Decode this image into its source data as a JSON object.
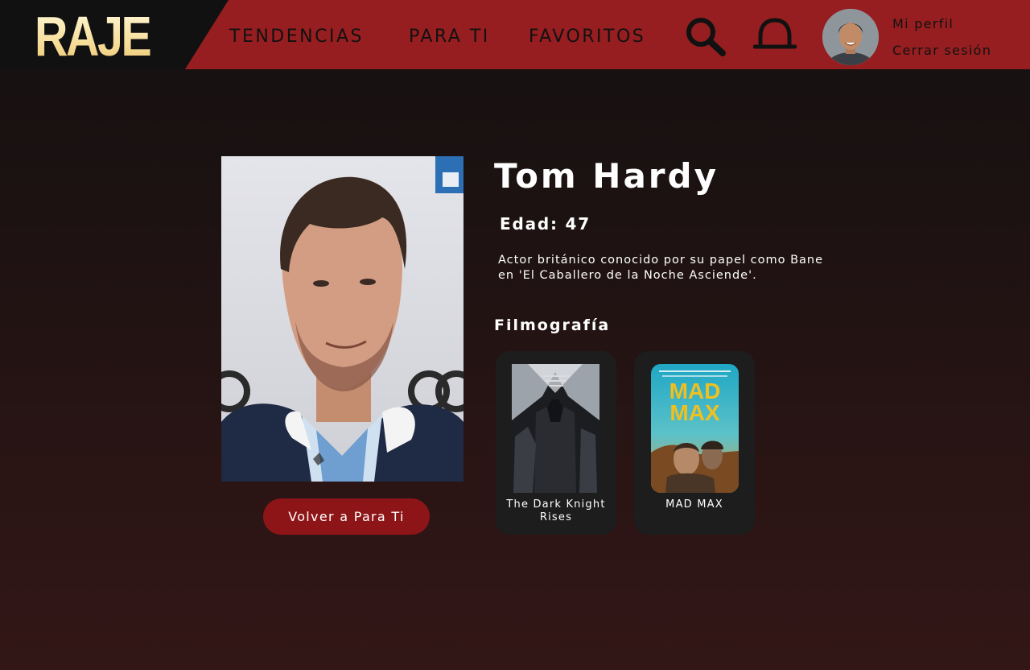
{
  "header": {
    "logo": "RAJE",
    "nav": [
      "TENDENCIAS",
      "PARA TI",
      "FAVORITOS"
    ],
    "profile_label": "Mi perfil",
    "logout_label": "Cerrar sesión"
  },
  "actor": {
    "name": "Tom Hardy",
    "age": "Edad: 47",
    "bio": "Actor británico conocido por su papel como Bane en 'El Caballero de la Noche Asciende'."
  },
  "filmography": {
    "title": "Filmografía",
    "movies": [
      {
        "title": "The Dark Knight Rises"
      },
      {
        "title": "MAD MAX"
      }
    ]
  },
  "back_button": "Volver a Para Ti",
  "colors": {
    "header_red": "#961e20",
    "logo_bg": "#111111",
    "button_red": "#8e1517",
    "card_bg": "#1d1d1d"
  },
  "icons": [
    "search-icon",
    "bell-icon"
  ]
}
